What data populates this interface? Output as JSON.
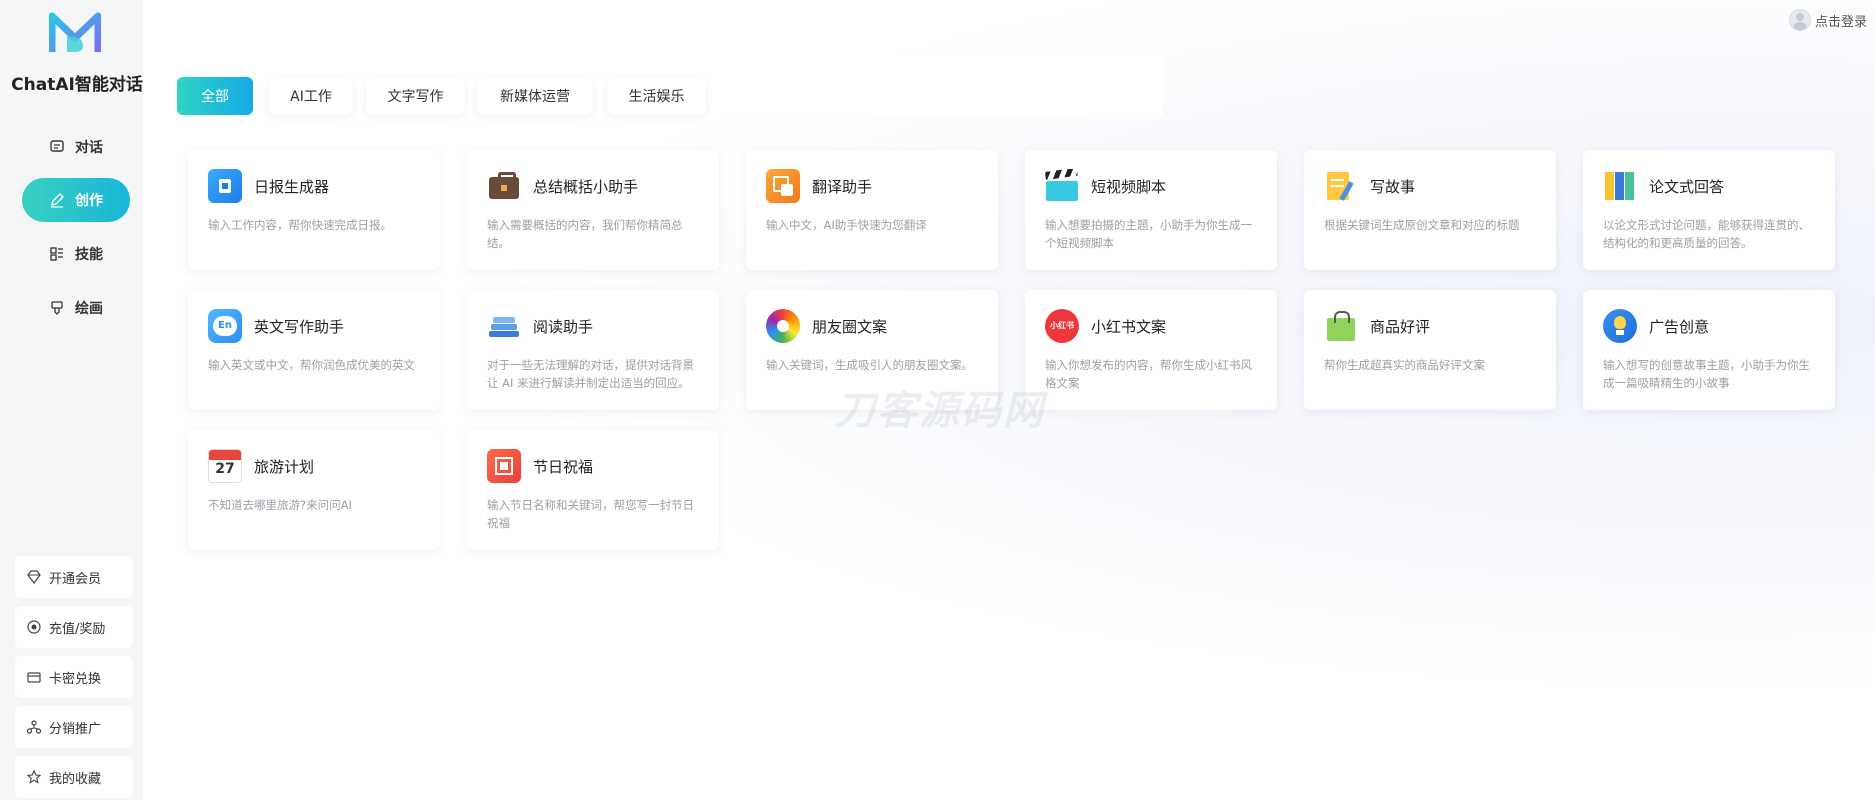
{
  "brand": {
    "name": "ChatAI智能对话"
  },
  "header": {
    "login_label": "点击登录"
  },
  "nav": [
    {
      "label": "对话",
      "icon": "chat-icon"
    },
    {
      "label": "创作",
      "icon": "pen-icon",
      "active": true
    },
    {
      "label": "技能",
      "icon": "grid-icon"
    },
    {
      "label": "绘画",
      "icon": "brush-icon"
    }
  ],
  "bottom_nav": [
    {
      "label": "开通会员",
      "icon": "diamond-icon"
    },
    {
      "label": "充值/奖励",
      "icon": "coin-icon"
    },
    {
      "label": "卡密兑换",
      "icon": "card-icon"
    },
    {
      "label": "分销推广",
      "icon": "share-icon"
    },
    {
      "label": "我的收藏",
      "icon": "star-icon"
    }
  ],
  "tabs": [
    "全部",
    "AI工作",
    "文字写作",
    "新媒体运营",
    "生活娱乐"
  ],
  "active_tab": "全部",
  "cards": [
    {
      "title": "日报生成器",
      "desc": "输入工作内容，帮你快速完成日报。",
      "icon": "report-icon"
    },
    {
      "title": "总结概括小助手",
      "desc": "输入需要概括的内容，我们帮你精简总结。",
      "icon": "briefcase-icon"
    },
    {
      "title": "翻译助手",
      "desc": "输入中文，AI助手快速为您翻译",
      "icon": "translate-icon"
    },
    {
      "title": "短视频脚本",
      "desc": "输入想要拍摄的主题，小助手为你生成一个短视频脚本",
      "icon": "clapper-icon"
    },
    {
      "title": "写故事",
      "desc": "根据关键词生成原创文章和对应的标题",
      "icon": "story-icon"
    },
    {
      "title": "论文式回答",
      "desc": "以论文形式讨论问题，能够获得连贯的、结构化的和更高质量的回答。",
      "icon": "folders-icon"
    },
    {
      "title": "英文写作助手",
      "desc": "输入英文或中文，帮你润色成优美的英文",
      "icon": "english-icon"
    },
    {
      "title": "阅读助手",
      "desc": "对于一些无法理解的对话，提供对话背景让 AI 来进行解读并制定出适当的回应。",
      "icon": "books-icon"
    },
    {
      "title": "朋友圈文案",
      "desc": "输入关键词，生成吸引人的朋友圈文案。",
      "icon": "moments-icon"
    },
    {
      "title": "小红书文案",
      "desc": "输入你想发布的内容，帮你生成小红书风格文案",
      "icon": "xiaohongshu-icon"
    },
    {
      "title": "商品好评",
      "desc": "帮你生成超真实的商品好评文案",
      "icon": "shopping-bag-icon"
    },
    {
      "title": "广告创意",
      "desc": "输入想写的创意故事主题，小助手为你生成一篇吸睛精生的小故事",
      "icon": "bulb-icon"
    },
    {
      "title": "旅游计划",
      "desc": "不知道去哪里旅游?来问问AI",
      "icon": "calendar-icon",
      "icon_text": "27"
    },
    {
      "title": "节日祝福",
      "desc": "输入节日名称和关键词，帮您写一封节日祝福",
      "icon": "festival-icon"
    }
  ],
  "icon_texts": {
    "english": "En",
    "xiaohongshu": "小红书"
  },
  "watermark": "刀客源码网",
  "colors": {
    "accent_start": "#3ad1c1",
    "accent_end": "#17a9e6"
  }
}
